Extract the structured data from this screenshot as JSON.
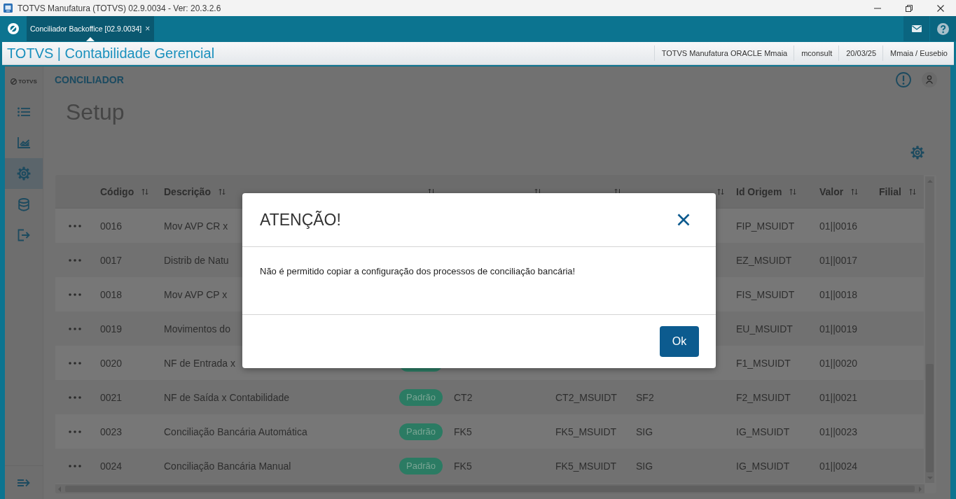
{
  "window": {
    "title": "TOTVS Manufatura (TOTVS) 02.9.0034 - Ver: 20.3.2.6"
  },
  "tabs": [
    {
      "label": "Conciliador Backoffice [02.9.0034]",
      "close": "×",
      "selected": true
    }
  ],
  "app_header": {
    "title": "TOTVS | Contabilidade Gerencial",
    "info": [
      "TOTVS Manufatura ORACLE Mmaia",
      "mconsult",
      "20/03/25",
      "Mmaia / Eusebio"
    ]
  },
  "sidebar": {
    "logo": "TOTVS",
    "items": [
      {
        "kind": "list",
        "selected": false
      },
      {
        "kind": "chart",
        "selected": false
      },
      {
        "kind": "settings",
        "selected": true
      },
      {
        "kind": "database",
        "selected": false
      },
      {
        "kind": "exit",
        "selected": false
      }
    ]
  },
  "module": {
    "title": "CONCILIADOR"
  },
  "page": {
    "title": "Setup"
  },
  "table": {
    "columns": [
      {
        "label": "Código",
        "sortable": true
      },
      {
        "label": "Descrição",
        "sortable": true
      },
      {
        "sortable": true
      },
      {
        "sortable": true
      },
      {
        "sortable": true
      },
      {
        "sortable": true
      },
      {
        "label": "Id Origem",
        "sortable": true
      },
      {
        "label": "Valor",
        "sortable": true
      },
      {
        "label": "Filial",
        "sortable": true
      }
    ],
    "rows": [
      {
        "codigo": "0016",
        "descricao": "Mov AVP CR x",
        "id_origem": "FIP_MSUIDT",
        "valor": "01||0016"
      },
      {
        "codigo": "0017",
        "descricao": "Distrib de Natu",
        "id_origem": "EZ_MSUIDT",
        "valor": "01||0017"
      },
      {
        "codigo": "0018",
        "descricao": "Mov AVP CP x",
        "id_origem": "FIS_MSUIDT",
        "valor": "01||0018"
      },
      {
        "codigo": "0019",
        "descricao": "Movimentos do",
        "id_origem": "EU_MSUIDT",
        "valor": "01||0019"
      },
      {
        "codigo": "0020",
        "descricao": "NF de Entrada x",
        "badge": true,
        "id_origem": "F1_MSUIDT",
        "valor": "01||0020"
      },
      {
        "codigo": "0021",
        "descricao": "NF de Saída x Contabilidade",
        "badge": true,
        "tipo": "Padrão",
        "tabela_destino": "CT2",
        "id_destino": "CT2_MSUIDT",
        "tabela_origem": "SF2",
        "id_origem": "F2_MSUIDT",
        "valor": "01||0021"
      },
      {
        "codigo": "0023",
        "descricao": "Conciliação Bancária Automática",
        "badge": true,
        "tipo": "Padrão",
        "tabela_destino": "FK5",
        "id_destino": "FK5_MSUIDT",
        "tabela_origem": "SIG",
        "id_origem": "IG_MSUIDT",
        "valor": "01||0023"
      },
      {
        "codigo": "0024",
        "descricao": "Conciliação Bancária Manual",
        "badge": true,
        "tipo": "Padrão",
        "tabela_destino": "FK5",
        "id_destino": "FK5_MSUIDT",
        "tabela_origem": "SIG",
        "id_origem": "IG_MSUIDT",
        "valor": "01||0024"
      }
    ]
  },
  "dialog": {
    "title": "ATENÇÃO!",
    "message": "Não é permitido copiar a configuração dos processos de conciliação bancária!",
    "buttons": [
      "Ok"
    ]
  }
}
